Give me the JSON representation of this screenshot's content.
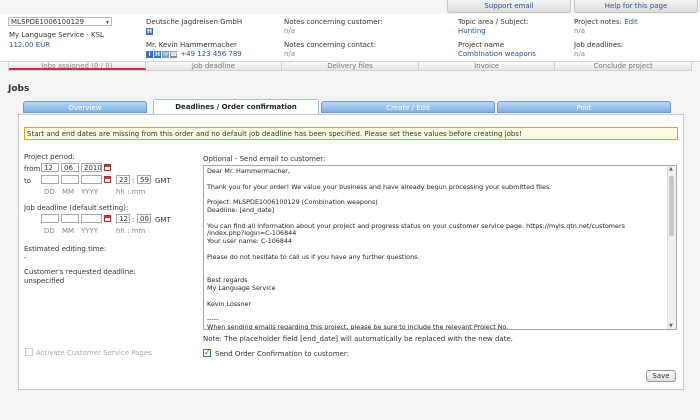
{
  "top_buttons": {
    "support": "Support email",
    "help": "Help for this page"
  },
  "order": {
    "number": "MLSPDE1006100129",
    "client": "My Language Service - KSL",
    "amount": "112.00 EUR"
  },
  "contacts": {
    "agency": "Deutsche Jagdreisen GmbH",
    "contact_name": "Mr. Kevin Hammermacher",
    "phone": "+49 123 456 789",
    "badge_letter": "H"
  },
  "notes": {
    "customer_label": "Notes concerning customer:",
    "customer_value": "n/a",
    "contact_label": "Notes concerning contact:",
    "contact_value": "n/a"
  },
  "topic": {
    "label": "Topic area / Subject:",
    "value": "Hunting",
    "project_label": "Project name",
    "project_value": "Combination weapons"
  },
  "project_notes": {
    "label": "Project notes:",
    "edit": "Edit",
    "value": "n/a",
    "deadlines_label": "Job deadlines:",
    "deadlines_value": "n/a"
  },
  "section_tabs": [
    "Jobs assigned (0 / 0)",
    "Job deadline",
    "Delivery files",
    "Invoice",
    "Conclude project"
  ],
  "page_title": "Jobs",
  "tabs": [
    "Overview",
    "Deadlines / Order confirmation",
    "Create / Edit",
    "Post"
  ],
  "warning": "Start and end dates are missing from this order and no default job deadline has been specified. Please set these values before creating jobs!",
  "period": {
    "label": "Project period:",
    "from_label": "from",
    "to_label": "to",
    "from_day": "12",
    "from_month": "06",
    "from_year": "2010",
    "from_hh": "23",
    "from_mm": "59",
    "gmt": "GMT",
    "date_hint": [
      "DD",
      "MM",
      "YYYY"
    ],
    "time_hint": "hh : mm"
  },
  "default_deadline": {
    "label": "Job deadline (default setting):",
    "hh": "12",
    "mm": "00"
  },
  "estimated": {
    "label": "Estimated editing time:",
    "value": "-"
  },
  "requested": {
    "label": "Customer's requested deadline:",
    "value": "unspecified"
  },
  "activate_label": "Activate Customer Service Pages",
  "email": {
    "label": "Optional - Send email to customer:",
    "body": "Dear Mr. Hammermacher,\n\nThank you for your order! We value your business and have already begun processing your submitted files.\n\nProject: MLSPDE1006100129 (Combination weapons)\nDeadline: [end_date]\n\nYou can find all information about your project and progress status on your customer service page: https://myls.qtn.net/customers\n/index.php?login=C-106844\nYour user name: C-106844\n\nPlease do not hesitate to call us if you have any further questions.\n\n\nBest regards\nMy Language Service\n\nKevin Lossner\n\n-----\nWhen sending emails regarding this project, please be sure to include the relevant Project No.\nYour Project No.: MLSPDE1006100129",
    "note": "Note: The placeholder field [end_date] will automatically be replaced with the new date.",
    "send_label": "Send Order Confirmation to customer:"
  },
  "save_label": "Save"
}
